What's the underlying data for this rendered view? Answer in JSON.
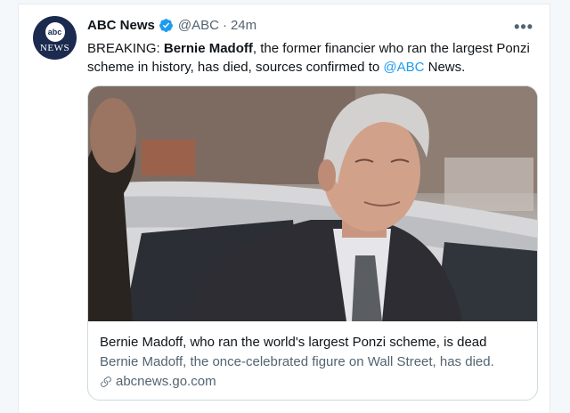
{
  "tweet": {
    "author_name": "ABC News",
    "handle": "@ABC",
    "separator": "·",
    "time": "24m",
    "more_label": "•••",
    "avatar": {
      "logo_text": "abc",
      "news_text": "NEWS"
    },
    "text": {
      "prefix": "BREAKING: ",
      "bold": "Bernie Madoff",
      "middle": ", the former financier who ran the largest Ponzi scheme in history, has died, sources confirmed to ",
      "mention": "@ABC",
      "suffix": " News."
    },
    "card": {
      "title": "Bernie Madoff, who ran the world's largest Ponzi scheme, is dead",
      "description": "Bernie Madoff, the once-celebrated figure on Wall Street, has died.",
      "domain": "abcnews.go.com",
      "image_icon": "photo-of-man-in-suit"
    }
  },
  "colors": {
    "link": "#1d9bf0",
    "verified": "#1d9bf0",
    "muted": "#536471",
    "text": "#0f1419",
    "border": "#cfd9de"
  }
}
